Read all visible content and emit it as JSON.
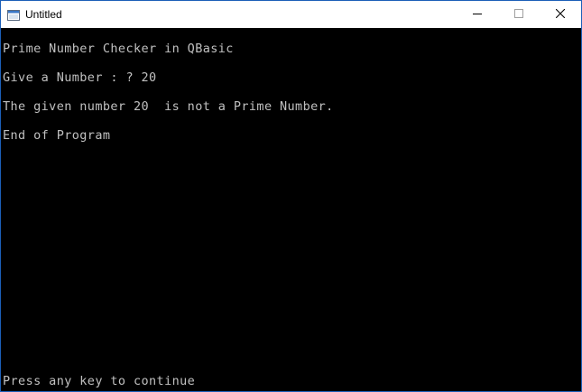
{
  "window": {
    "title": "Untitled",
    "icons": {
      "app": "console-window-icon",
      "minimize": "minimize-icon",
      "maximize": "maximize-icon",
      "close": "close-icon"
    }
  },
  "console": {
    "lines": [
      "Prime Number Checker in QBasic",
      "Give a Number : ? 20",
      "The given number 20  is not a Prime Number.",
      "End of Program"
    ],
    "footer": "Press any key to continue"
  },
  "colors": {
    "console_bg": "#000000",
    "console_text": "#c0c0c0",
    "titlebar_bg": "#ffffff",
    "window_border": "#1c5fb8"
  }
}
